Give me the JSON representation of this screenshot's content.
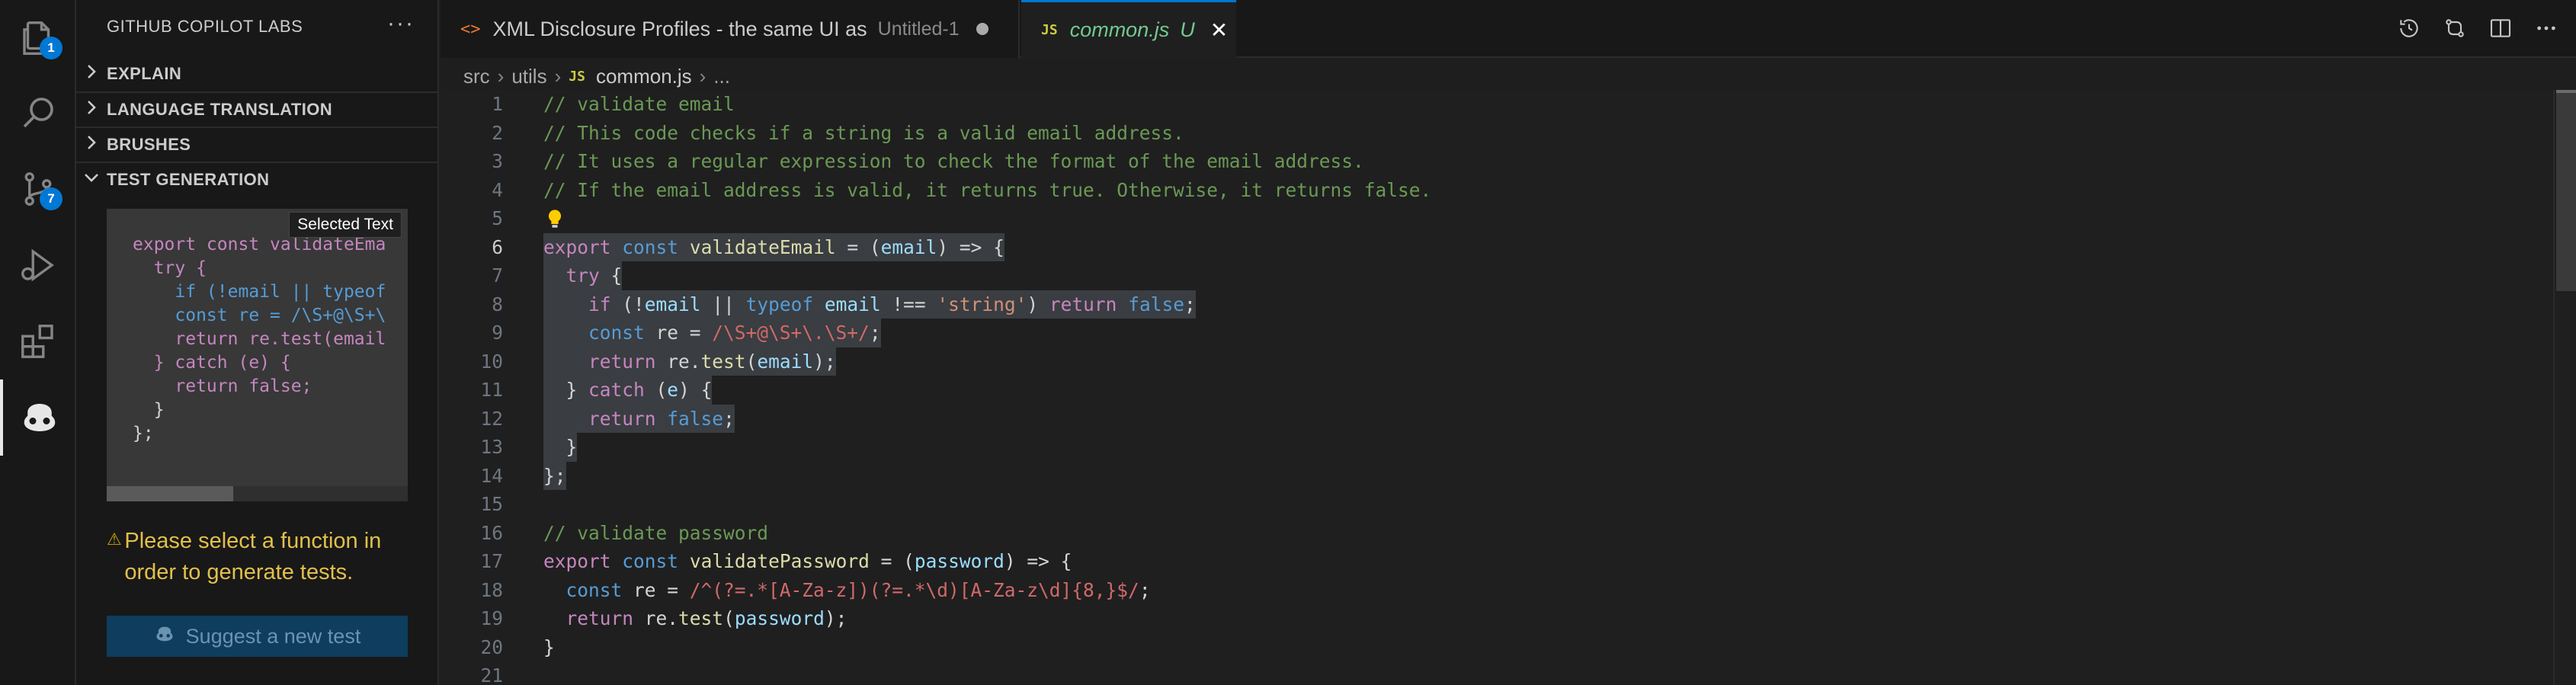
{
  "activity_bar": {
    "items": [
      {
        "name": "explorer-icon",
        "badge": "1"
      },
      {
        "name": "search-icon",
        "badge": ""
      },
      {
        "name": "source-control-icon",
        "badge": "7"
      },
      {
        "name": "run-debug-icon",
        "badge": ""
      },
      {
        "name": "extensions-icon",
        "badge": ""
      },
      {
        "name": "copilot-labs-icon",
        "badge": ""
      }
    ]
  },
  "sidebar": {
    "title": "GITHUB COPILOT LABS",
    "more": "···",
    "sections": [
      {
        "label": "EXPLAIN",
        "expanded": false
      },
      {
        "label": "LANGUAGE TRANSLATION",
        "expanded": false
      },
      {
        "label": "BRUSHES",
        "expanded": false
      },
      {
        "label": "TEST GENERATION",
        "expanded": true
      }
    ],
    "preview_tooltip": "Selected Text",
    "preview_code": [
      "export const validateEma",
      "  try {",
      "    if (!email || typeof ",
      "    const re = /\\S+@\\S+\\",
      "    return re.test(email",
      "  } catch (e) {",
      "    return false;",
      "  }",
      "};"
    ],
    "warning_text": "Please select a function in order to generate tests.",
    "suggest_button": "Suggest a new test"
  },
  "tabs": [
    {
      "icon": "<>",
      "name": "XML Disclosure Profiles - the same UI as",
      "description": "Untitled-1",
      "dirty": true
    },
    {
      "icon": "JS",
      "name": "common.js",
      "status": "U",
      "close": "✕",
      "active": true
    }
  ],
  "breadcrumb": {
    "parts": [
      "src",
      "utils"
    ],
    "file_icon": "JS",
    "file": "common.js",
    "tail": "..."
  },
  "editor": {
    "current_line": 6,
    "line_numbers": [
      "1",
      "2",
      "3",
      "4",
      "5",
      "6",
      "7",
      "8",
      "9",
      "10",
      "11",
      "12",
      "13",
      "14",
      "15",
      "16",
      "17",
      "18",
      "19",
      "20",
      "21"
    ],
    "lines": [
      "// validate email",
      "// This code checks if a string is a valid email address.",
      "// It uses a regular expression to check the format of the email address.",
      "// If the email address is valid, it returns true. Otherwise, it returns false.",
      "",
      "export const validateEmail = (email) => {",
      "  try {",
      "    if (!email || typeof email !== 'string') return false;",
      "    const re = /\\S+@\\S+\\.\\S+/;",
      "    return re.test(email);",
      "  } catch (e) {",
      "    return false;",
      "  }",
      "};",
      "",
      "// validate password",
      "export const validatePassword = (password) => {",
      "  const re = /^(?=.*[A-Za-z])(?=.*\\d)[A-Za-z\\d]{8,}$/;",
      "  return re.test(password);",
      "}",
      ""
    ]
  },
  "colors": {
    "accent": "#0078d4",
    "warning": "#cca700",
    "comment": "#6a9955",
    "keyword": "#c586c0",
    "string": "#ce9178",
    "untracked": "#73c991"
  }
}
